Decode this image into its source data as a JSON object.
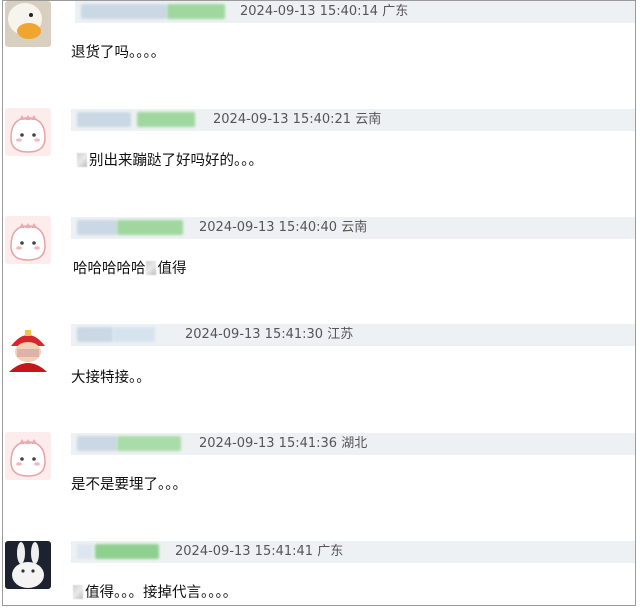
{
  "comments": [
    {
      "timestamp": "2024-09-13 15:40:14",
      "location": "广东",
      "text": "退货了吗。。。。",
      "avatar": "duck-avatar-icon"
    },
    {
      "timestamp": "2024-09-13 15:40:21",
      "location": "云南",
      "text": "别出来蹦跶了好吗好的。。。",
      "avatar": "pink-cartoon-avatar-icon"
    },
    {
      "timestamp": "2024-09-13 15:40:40",
      "location": "云南",
      "text": "哈哈哈哈哈",
      "text_after": "值得",
      "avatar": "pink-cartoon-avatar-icon"
    },
    {
      "timestamp": "2024-09-13 15:41:30",
      "location": "江苏",
      "text": "大接特接。。",
      "avatar": "red-character-avatar-icon"
    },
    {
      "timestamp": "2024-09-13 15:41:36",
      "location": "湖北",
      "text": "是不是要埋了。。。",
      "avatar": "pink-cartoon-avatar-icon"
    },
    {
      "timestamp": "2024-09-13 15:41:41",
      "location": "广东",
      "text": "值得。。。接掉代言。。。。",
      "avatar": "white-rabbit-avatar-icon"
    }
  ]
}
